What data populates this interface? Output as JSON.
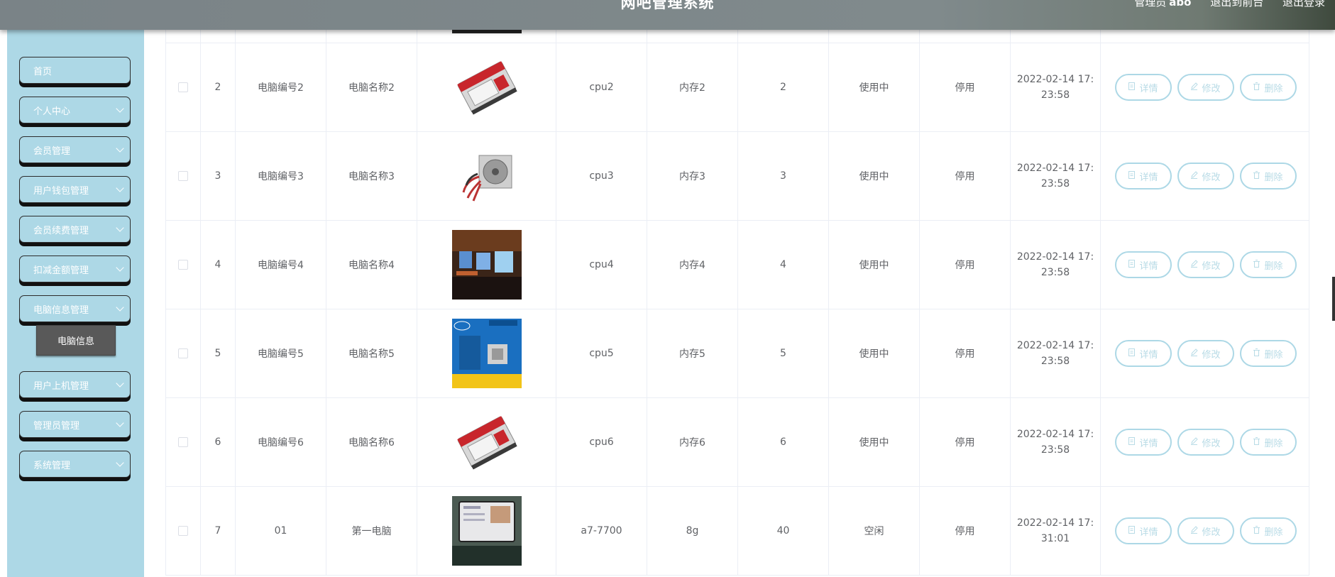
{
  "header": {
    "title": "网吧管理系统",
    "role": "管理员",
    "user": "abo",
    "to_front": "退出到前台",
    "logout": "退出登录"
  },
  "sidebar": {
    "items": [
      {
        "label": "首页"
      },
      {
        "label": "个人中心"
      },
      {
        "label": "会员管理"
      },
      {
        "label": "用户钱包管理"
      },
      {
        "label": "会员续费管理"
      },
      {
        "label": "扣减金额管理"
      },
      {
        "label": "电脑信息管理"
      },
      {
        "label": "用户上机管理"
      },
      {
        "label": "管理员管理"
      },
      {
        "label": "系统管理"
      }
    ],
    "sub_item": "电脑信息"
  },
  "actions": {
    "detail": "详情",
    "edit": "修改",
    "delete": "删除"
  },
  "rows": [
    {
      "index": "2",
      "pc_no": "电脑编号2",
      "pc_name": "电脑名称2",
      "cpu": "cpu2",
      "memory": "内存2",
      "count": "2",
      "status": "使用中",
      "state": "停用",
      "time_date": "2022-02-14 17:",
      "time_clock": "23:58",
      "image": "hard-drive-image"
    },
    {
      "index": "3",
      "pc_no": "电脑编号3",
      "pc_name": "电脑名称3",
      "cpu": "cpu3",
      "memory": "内存3",
      "count": "3",
      "status": "使用中",
      "state": "停用",
      "time_date": "2022-02-14 17:",
      "time_clock": "23:58",
      "image": "power-supply-image"
    },
    {
      "index": "4",
      "pc_no": "电脑编号4",
      "pc_name": "电脑名称4",
      "cpu": "cpu4",
      "memory": "内存4",
      "count": "4",
      "status": "使用中",
      "state": "停用",
      "time_date": "2022-02-14 17:",
      "time_clock": "23:58",
      "image": "internet-cafe-image"
    },
    {
      "index": "5",
      "pc_no": "电脑编号5",
      "pc_name": "电脑名称5",
      "cpu": "cpu5",
      "memory": "内存5",
      "count": "5",
      "status": "使用中",
      "state": "停用",
      "time_date": "2022-02-14 17:",
      "time_clock": "23:58",
      "image": "intel-cpu-box-image"
    },
    {
      "index": "6",
      "pc_no": "电脑编号6",
      "pc_name": "电脑名称6",
      "cpu": "cpu6",
      "memory": "内存6",
      "count": "6",
      "status": "使用中",
      "state": "停用",
      "time_date": "2022-02-14 17:",
      "time_clock": "23:58",
      "image": "hard-drive-image"
    },
    {
      "index": "7",
      "pc_no": "01",
      "pc_name": "第一电脑",
      "cpu": "a7-7700",
      "memory": "8g",
      "count": "40",
      "status": "空闲",
      "state": "停用",
      "time_date": "2022-02-14 17:",
      "time_clock": "31:01",
      "image": "tablet-image"
    }
  ],
  "colors": {
    "sidebar_bg": "#add8e6",
    "header_bg": "#7f888b",
    "button_border": "#add8e6",
    "active_sub": "#595959"
  }
}
